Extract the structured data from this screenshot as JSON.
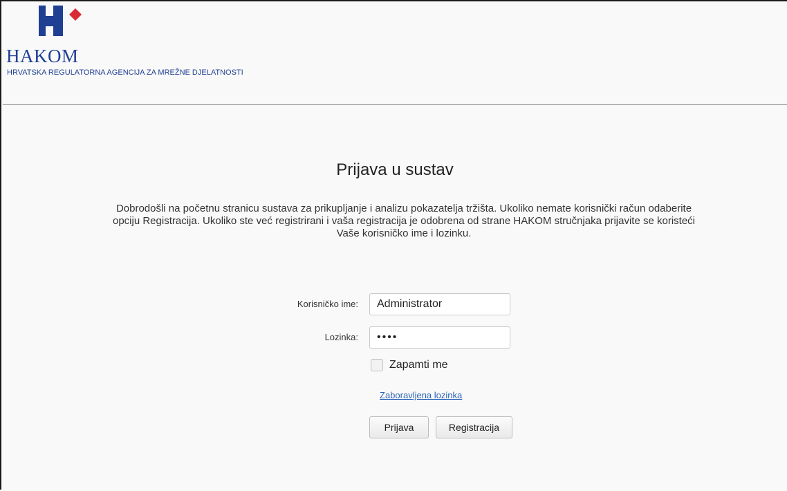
{
  "header": {
    "logo_name": "HAKOM",
    "agency_name": "HRVATSKA REGULATORNA AGENCIJA ZA MREŽNE DJELATNOSTI",
    "logo_icon": "hakom-logo-mark",
    "brand_color": "#1f3f93",
    "accent_color": "#d92b35"
  },
  "login": {
    "title": "Prijava u sustav",
    "welcome_line_1": "Dobrodošli na početnu stranicu sustava za prikupljanje i analizu pokazatelja tržišta. Ukoliko nemate korisnički račun odaberite",
    "welcome_line_2": "opciju Registracija. Ukoliko ste već registrirani i vaša registracija je odobrena od strane HAKOM stručnjaka prijavite se koristeći",
    "welcome_line_3": "Vaše korisničko ime i lozinku.",
    "username_label": "Korisničko ime:",
    "username_value": "Administrator",
    "password_label": "Lozinka:",
    "password_value": "1234",
    "remember_me_label": "Zapamti me",
    "remember_me_checked": false,
    "forgot_password_link": "Zaboravljena lozinka",
    "login_button": "Prijava",
    "register_button": "Registracija",
    "link_color": "#2a62b7"
  }
}
